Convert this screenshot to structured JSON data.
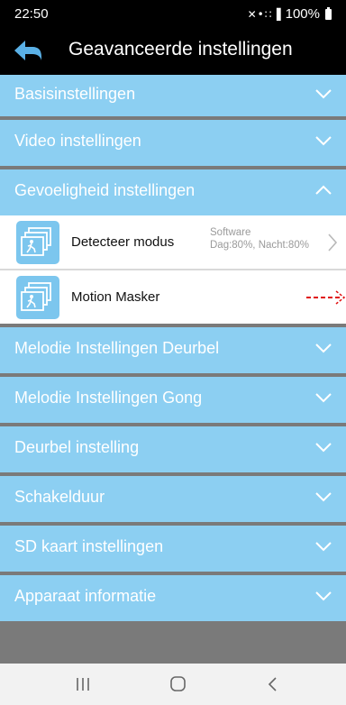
{
  "status_bar": {
    "time": "22:50",
    "battery": "100%"
  },
  "header": {
    "title": "Geavanceerde instellingen"
  },
  "sections_top": [
    {
      "label": "Basisinstellingen",
      "expanded": false
    },
    {
      "label": "Video instellingen",
      "expanded": false
    },
    {
      "label": "Gevoeligheid instellingen",
      "expanded": true
    }
  ],
  "sensitivity_items": [
    {
      "label": "Detecteer modus",
      "value_line1": "Software",
      "value_line2": "Dag:80%, Nacht:80%"
    },
    {
      "label": "Motion Masker"
    }
  ],
  "sections_bottom": [
    {
      "label": "Melodie Instellingen Deurbel",
      "expanded": false
    },
    {
      "label": "Melodie Instellingen Gong",
      "expanded": false
    },
    {
      "label": "Deurbel instelling",
      "expanded": false
    },
    {
      "label": "Schakelduur",
      "expanded": false
    },
    {
      "label": "SD kaart instellingen",
      "expanded": false
    },
    {
      "label": "Apparaat informatie",
      "expanded": false
    }
  ],
  "icons": {
    "back": "back-arrow-icon",
    "chevron_down": "chevron-down-icon",
    "chevron_up": "chevron-up-icon",
    "chevron_right": "chevron-right-icon",
    "motion_detection": "motion-detection-icon"
  },
  "colors": {
    "section_bg": "#8ccff2",
    "header_bg": "#000000",
    "annotation": "#e01010"
  }
}
